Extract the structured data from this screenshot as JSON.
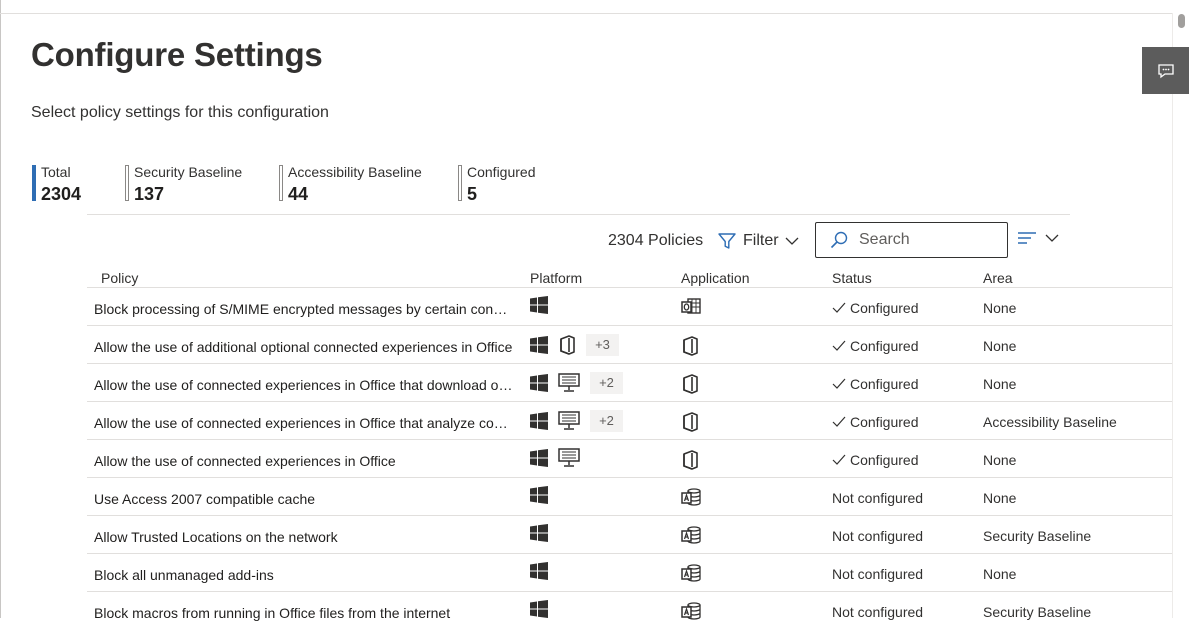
{
  "page": {
    "title": "Configure Settings",
    "subtitle": "Select policy settings for this configuration"
  },
  "stats": [
    {
      "label": "Total",
      "value": "2304"
    },
    {
      "label": "Security Baseline",
      "value": "137"
    },
    {
      "label": "Accessibility Baseline",
      "value": "44"
    },
    {
      "label": "Configured",
      "value": "5"
    }
  ],
  "toolbar": {
    "count": "2304 Policies",
    "filter_label": "Filter",
    "search_placeholder": "Search"
  },
  "columns": {
    "policy": "Policy",
    "platform": "Platform",
    "application": "Application",
    "status": "Status",
    "area": "Area"
  },
  "rows": [
    {
      "policy": "Block processing of S/MIME encrypted messages by certain connectors",
      "platforms": [
        "windows-icon"
      ],
      "extra": "",
      "app": "outlook-icon",
      "status": "Configured",
      "area": "None"
    },
    {
      "policy": "Allow the use of additional optional connected experiences in Office",
      "platforms": [
        "windows-icon",
        "office-icon"
      ],
      "extra": "+3",
      "app": "office-icon",
      "status": "Configured",
      "area": "None"
    },
    {
      "policy": "Allow the use of connected experiences in Office that download online content",
      "platforms": [
        "windows-icon",
        "monitor-icon"
      ],
      "extra": "+2",
      "app": "office-icon",
      "status": "Configured",
      "area": "None"
    },
    {
      "policy": "Allow the use of connected experiences in Office that analyze content",
      "platforms": [
        "windows-icon",
        "monitor-icon"
      ],
      "extra": "+2",
      "app": "office-icon",
      "status": "Configured",
      "area": "Accessibility Baseline"
    },
    {
      "policy": "Allow the use of connected experiences in Office",
      "platforms": [
        "windows-icon",
        "monitor-icon"
      ],
      "extra": "",
      "app": "office-icon",
      "status": "Configured",
      "area": "None"
    },
    {
      "policy": "Use Access 2007 compatible cache",
      "platforms": [
        "windows-icon"
      ],
      "extra": "",
      "app": "access-icon",
      "status": "Not configured",
      "area": "None"
    },
    {
      "policy": "Allow Trusted Locations on the network",
      "platforms": [
        "windows-icon"
      ],
      "extra": "",
      "app": "access-icon",
      "status": "Not configured",
      "area": "Security Baseline"
    },
    {
      "policy": "Block all unmanaged add-ins",
      "platforms": [
        "windows-icon"
      ],
      "extra": "",
      "app": "access-icon",
      "status": "Not configured",
      "area": "None"
    },
    {
      "policy": "Block macros from running in Office files from the internet",
      "platforms": [
        "windows-icon"
      ],
      "extra": "",
      "app": "access-icon",
      "status": "Not configured",
      "area": "Security Baseline"
    }
  ],
  "colors": {
    "accent": "#2e6db4",
    "text": "#323130",
    "border": "#e1dfdd"
  }
}
